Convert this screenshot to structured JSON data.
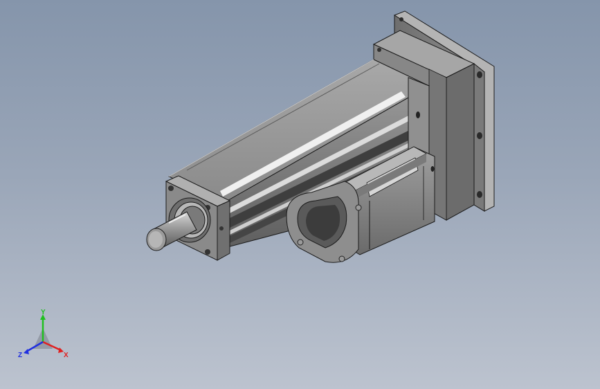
{
  "viewport": {
    "background_top": "#8595ab",
    "background_bottom": "#bcc3cf"
  },
  "model": {
    "body_color": "#8c8c8c",
    "dark_color": "#4a4a4a",
    "highlight_color": "#e6e6e6",
    "edge_color": "#1a1a1a"
  },
  "triad": {
    "x_label": "X",
    "y_label": "Y",
    "z_label": "Z",
    "x_color": "#e02020",
    "y_color": "#20c020",
    "z_color": "#2030e0"
  }
}
